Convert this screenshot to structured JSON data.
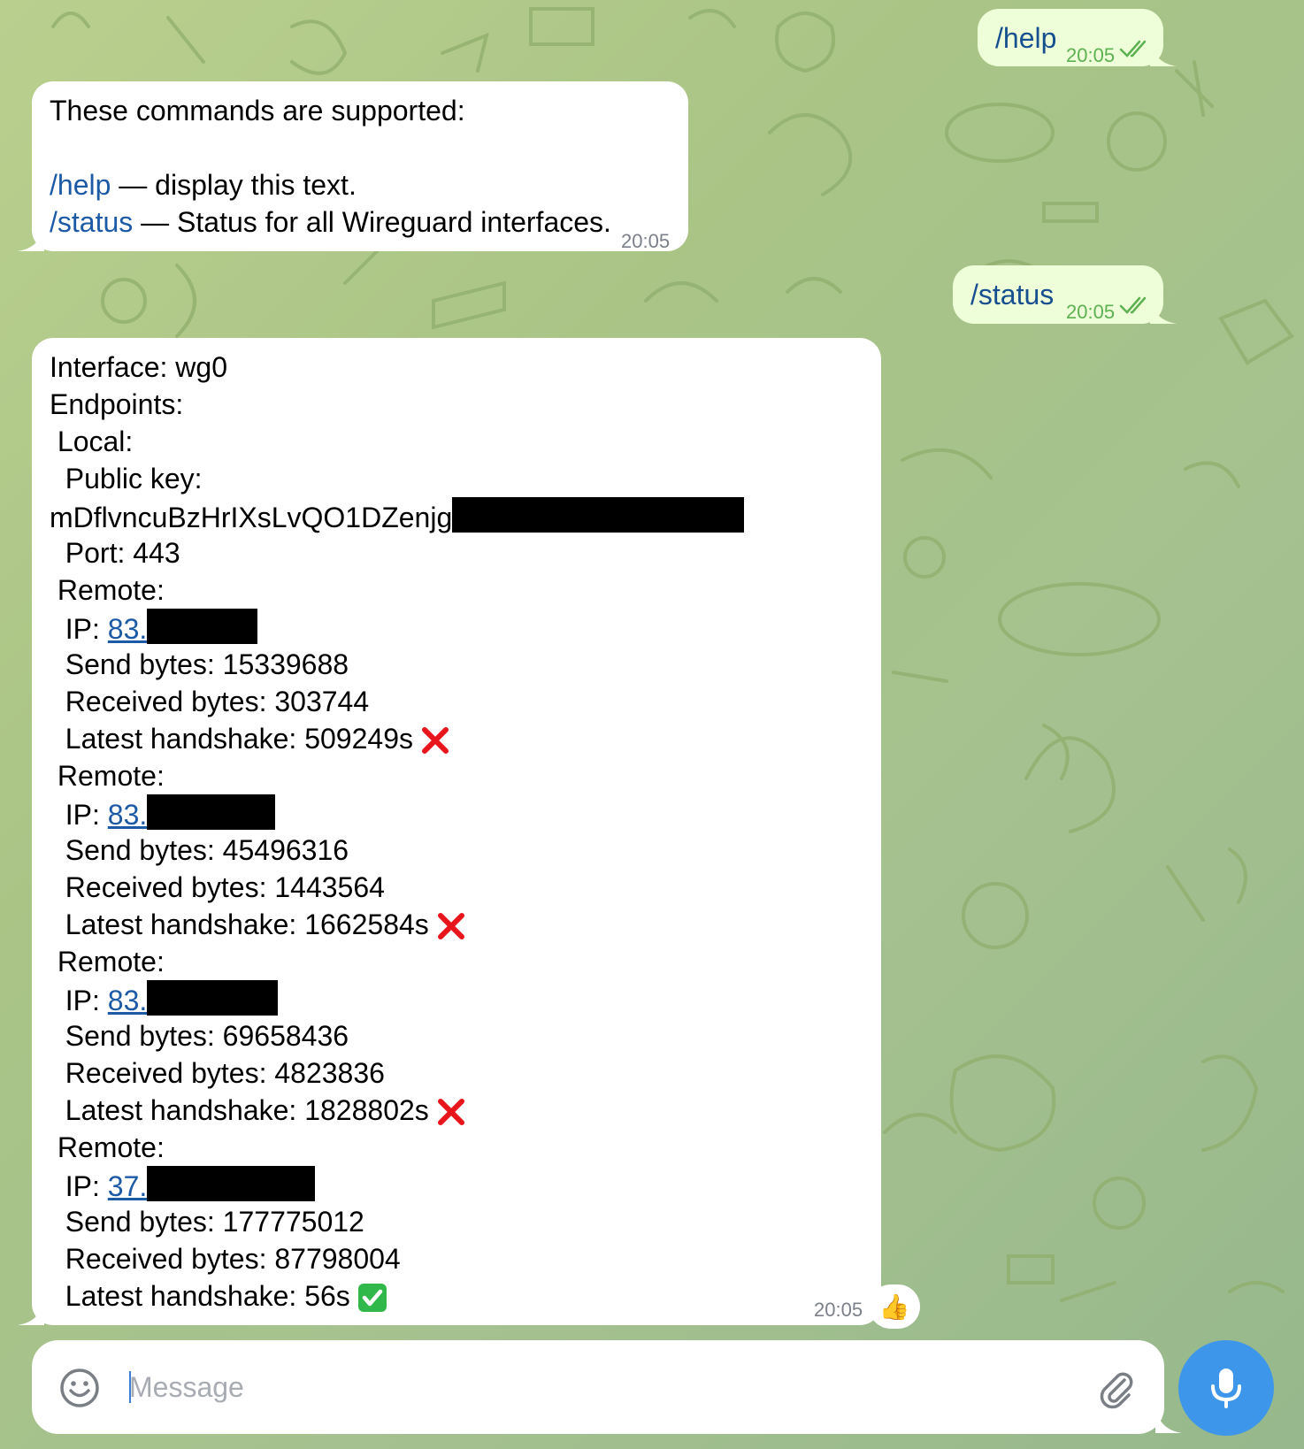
{
  "messages": [
    {
      "direction": "outgoing",
      "text": "/help",
      "time": "20:05",
      "status": "read"
    },
    {
      "direction": "incoming",
      "time": "20:05",
      "lines": [
        {
          "text": "These commands are supported:"
        },
        {
          "text": ""
        },
        {
          "command": "/help",
          "text": " — display this text."
        },
        {
          "command": "/status",
          "text": " — Status for all Wireguard interfaces."
        }
      ]
    },
    {
      "direction": "outgoing",
      "text": "/status",
      "time": "20:05",
      "status": "read"
    },
    {
      "direction": "incoming",
      "time": "20:05",
      "reaction": "👍",
      "interface_line": "Interface: wg0",
      "endpoints_label": "Endpoints:",
      "local_label": " Local:",
      "public_key_label": "  Public key:",
      "public_key_visible": "mDflvncuBzHrIXsLvQO1DZenjg",
      "port_line": "  Port: 443",
      "remotes": [
        {
          "label": " Remote:",
          "ip_label": "  IP: ",
          "ip_visible": "83.",
          "send": "  Send bytes: 15339688",
          "received": "  Received bytes: 303744",
          "handshake": "  Latest handshake: 509249s",
          "handshake_ok": false
        },
        {
          "label": " Remote:",
          "ip_label": "  IP: ",
          "ip_visible": "83.",
          "send": "  Send bytes: 45496316",
          "received": "  Received bytes: 1443564",
          "handshake": "  Latest handshake: 1662584s",
          "handshake_ok": false
        },
        {
          "label": " Remote:",
          "ip_label": "  IP: ",
          "ip_visible": "83.",
          "send": "  Send bytes: 69658436",
          "received": "  Received bytes: 4823836",
          "handshake": "  Latest handshake: 1828802s",
          "handshake_ok": false
        },
        {
          "label": " Remote:",
          "ip_label": "  IP: ",
          "ip_visible": "37.",
          "send": "  Send bytes: 177775012",
          "received": "  Received bytes: 87798004",
          "handshake": "  Latest handshake: 56s",
          "handshake_ok": true
        }
      ]
    }
  ],
  "composer": {
    "placeholder": "Message"
  },
  "icons": {
    "emoji": "smile-icon",
    "attach": "paperclip-icon",
    "mic": "microphone-icon",
    "read": "double-check-icon",
    "fail": "cross-mark-icon",
    "ok": "check-mark-button-icon"
  },
  "colors": {
    "incoming_bubble": "#ffffff",
    "outgoing_bubble": "#eefed8",
    "link": "#1c5aa6",
    "outgoing_time": "#5cb251",
    "mic_button": "#3d96ea",
    "fail_mark": "#e8161c",
    "ok_mark": "#30b94a"
  }
}
